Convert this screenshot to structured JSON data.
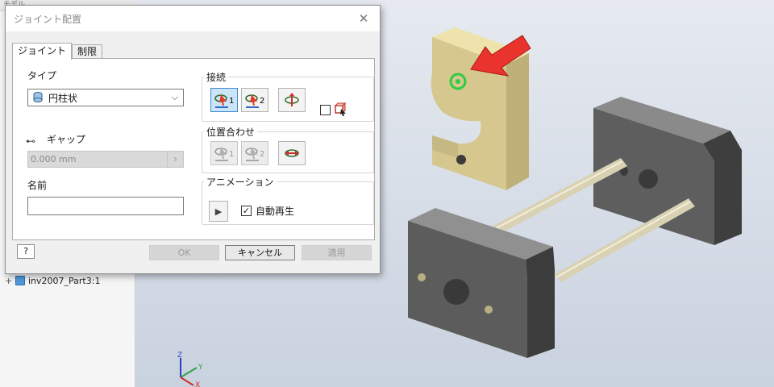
{
  "dialog": {
    "title": "ジョイント配置",
    "tabs": [
      {
        "label": "ジョイント"
      },
      {
        "label": "制限"
      }
    ],
    "type": {
      "label": "タイプ",
      "selected": "円柱状"
    },
    "gap": {
      "label": "ギャップ",
      "value": "0.000 mm"
    },
    "name": {
      "label": "名前",
      "value": ""
    },
    "connect": {
      "legend": "接続",
      "button1": "1",
      "button2": "2"
    },
    "align": {
      "legend": "位置合わせ",
      "button1": "1",
      "button2": "2"
    },
    "animation": {
      "legend": "アニメーション",
      "autoplay_label": "自動再生",
      "autoplay_checked": true
    },
    "footer": {
      "help": "?",
      "ok": "OK",
      "cancel": "キャンセル",
      "apply": "適用"
    }
  },
  "browser": {
    "header": "モデル",
    "item": {
      "expander": "+",
      "label": "inv2007_Part3:1"
    }
  },
  "triad": {
    "x": "X",
    "y": "Y",
    "z": "Z"
  },
  "colors": {
    "accent": "#3d8ad6",
    "highlight": "#2ecc40",
    "arrow": "#e8342c",
    "part_gold": "#d7c98f",
    "block_gray": "#5a5a5a"
  }
}
